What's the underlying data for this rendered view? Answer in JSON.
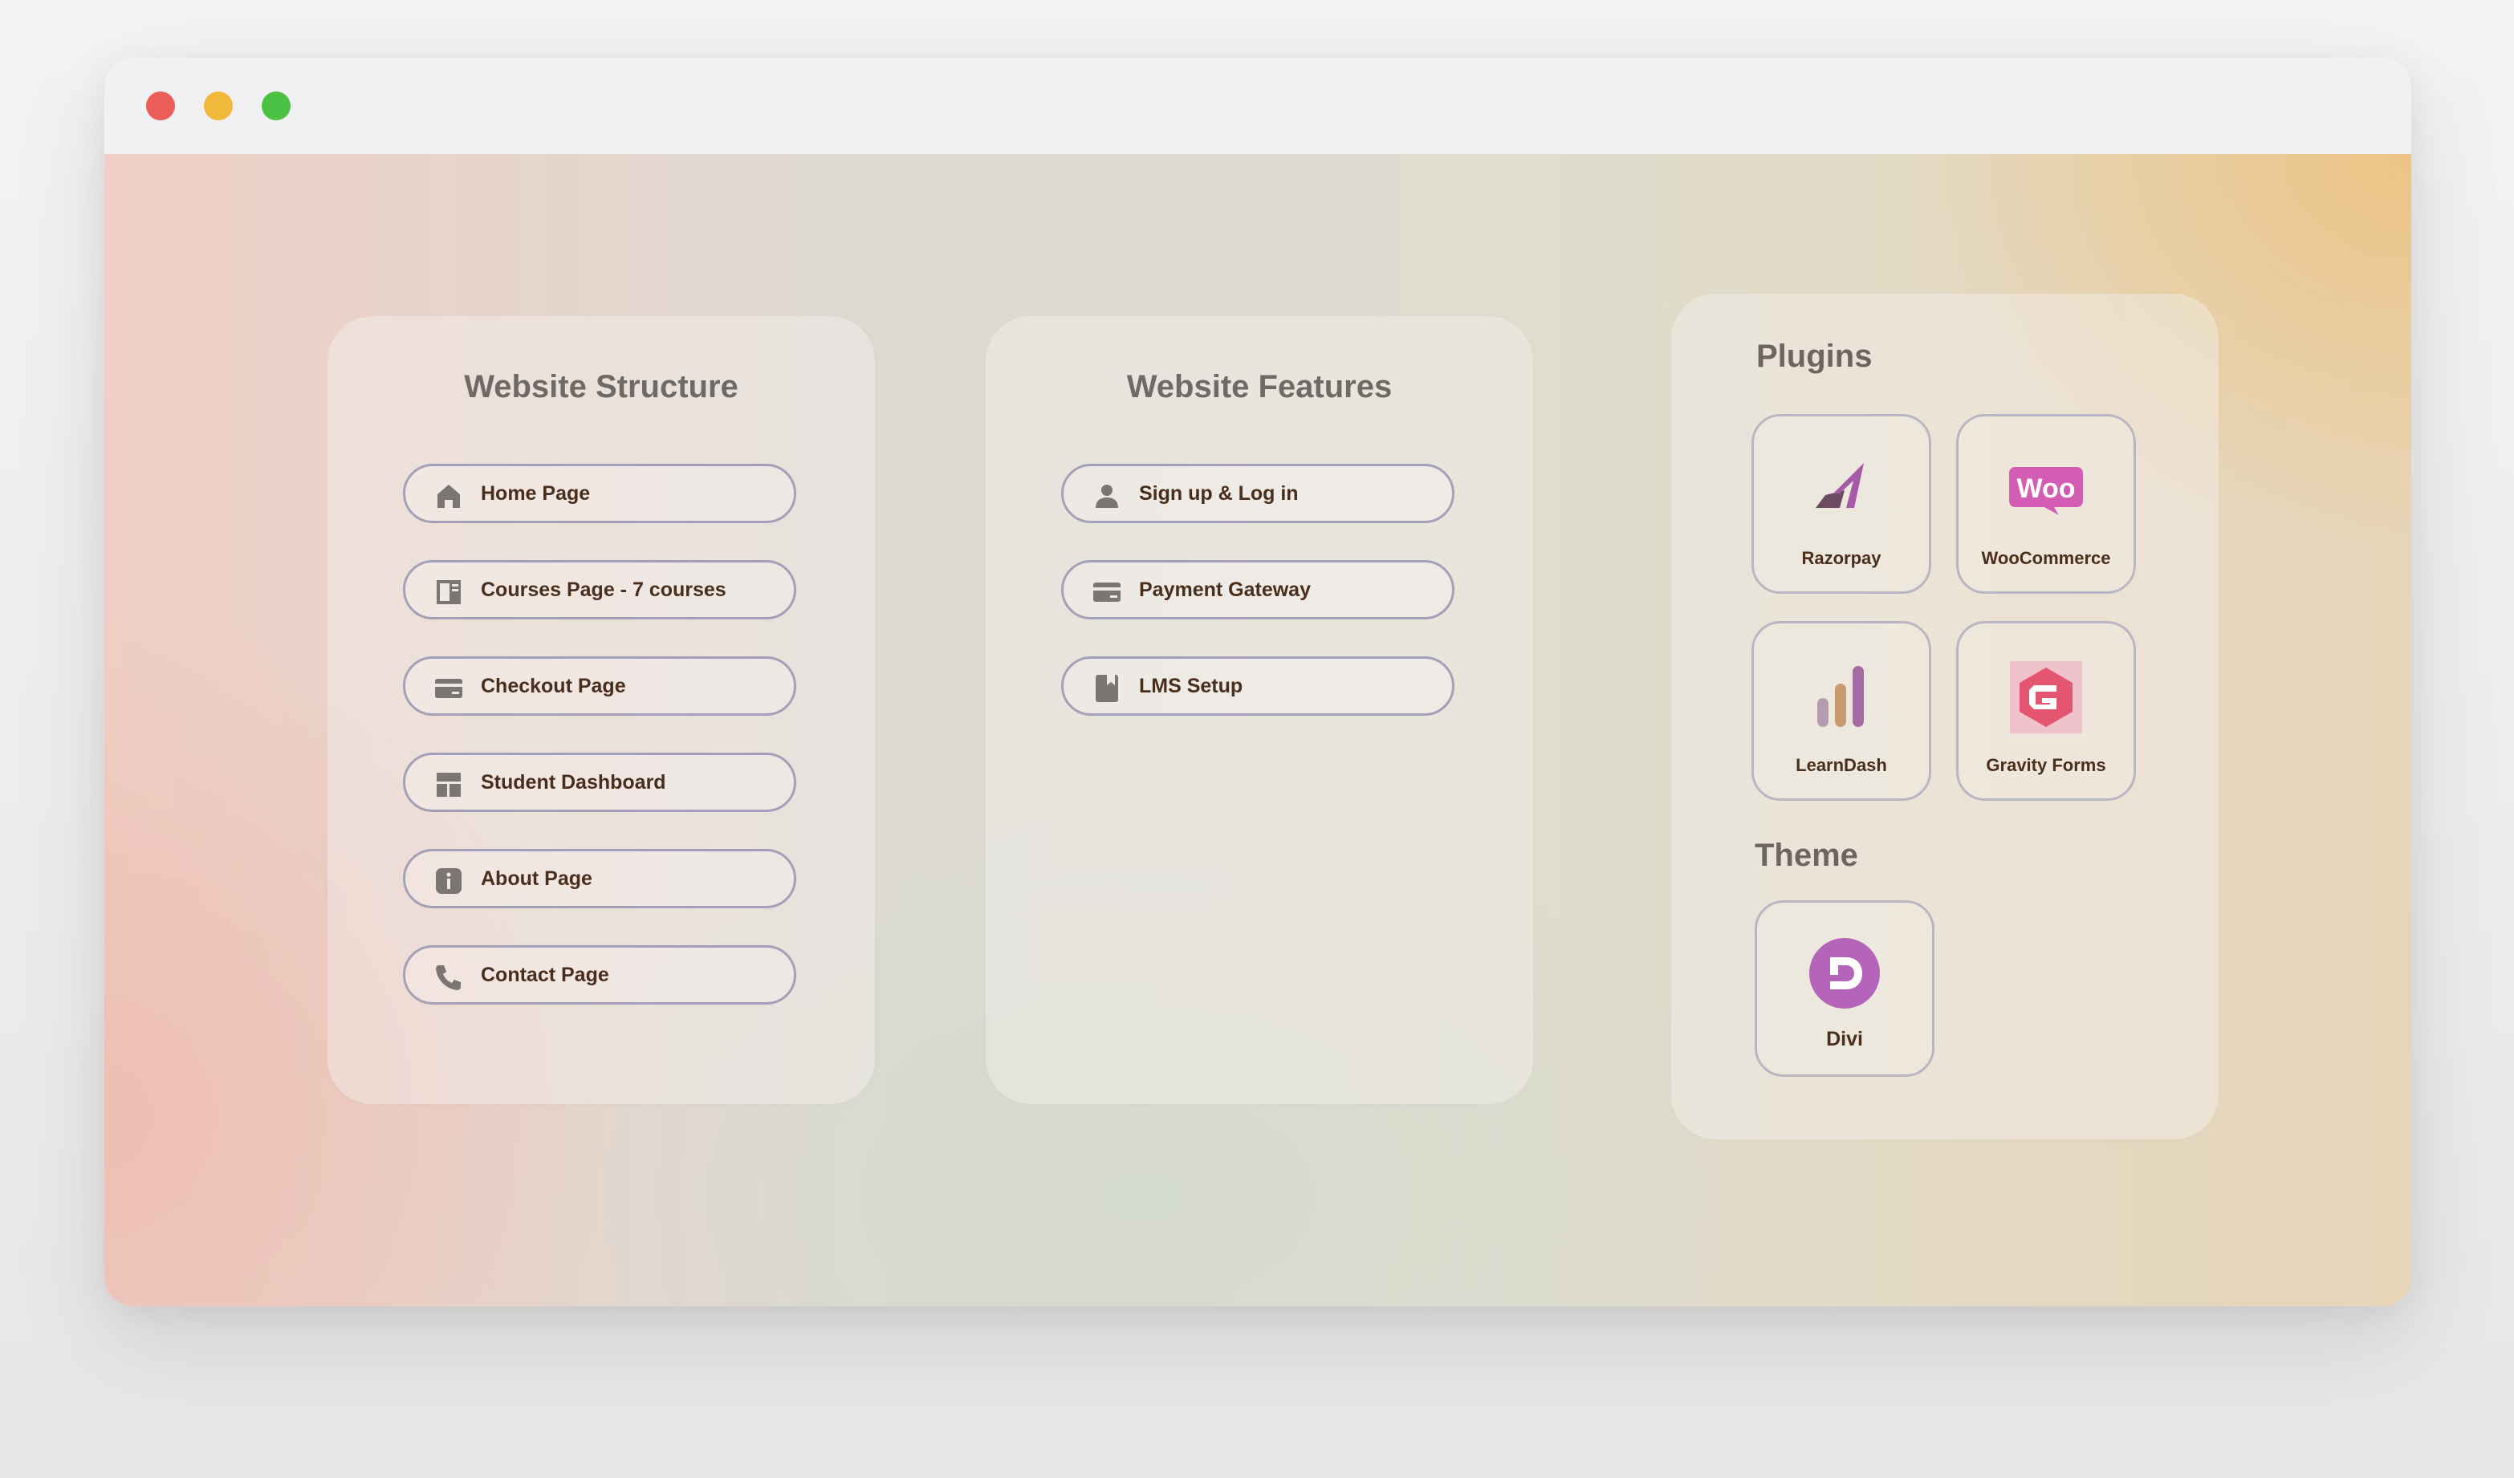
{
  "window": {
    "controls": [
      "close",
      "minimize",
      "maximize"
    ]
  },
  "structure": {
    "title": "Website Structure",
    "items": [
      {
        "label": "Home Page",
        "icon": "home-icon"
      },
      {
        "label": "Courses Page - 7 courses",
        "icon": "document-icon"
      },
      {
        "label": "Checkout Page",
        "icon": "card-icon"
      },
      {
        "label": "Student Dashboard",
        "icon": "dashboard-icon"
      },
      {
        "label": "About Page",
        "icon": "info-icon"
      },
      {
        "label": "Contact Page",
        "icon": "phone-icon"
      }
    ]
  },
  "features": {
    "title": "Website Features",
    "items": [
      {
        "label": "Sign up & Log in",
        "icon": "person-icon"
      },
      {
        "label": "Payment Gateway",
        "icon": "card-icon"
      },
      {
        "label": "LMS Setup",
        "icon": "book-icon"
      }
    ]
  },
  "plugins": {
    "title": "Plugins",
    "items": [
      {
        "label": "Razorpay",
        "icon": "razorpay-logo-icon"
      },
      {
        "label": "WooCommerce",
        "icon": "woocommerce-logo-icon",
        "logo_text": "Woo"
      },
      {
        "label": "LearnDash",
        "icon": "learndash-logo-icon"
      },
      {
        "label": "Gravity Forms",
        "icon": "gravity-forms-logo-icon"
      }
    ]
  },
  "theme": {
    "title": "Theme",
    "items": [
      {
        "label": "Divi",
        "icon": "divi-logo-icon"
      }
    ]
  },
  "colors": {
    "close": "#ec5e57",
    "minimize": "#f1b93a",
    "maximize": "#4cc245",
    "label_text": "#4a2e1c",
    "heading_text": "#6f6a66",
    "pill_border": "#a3a0b8"
  }
}
